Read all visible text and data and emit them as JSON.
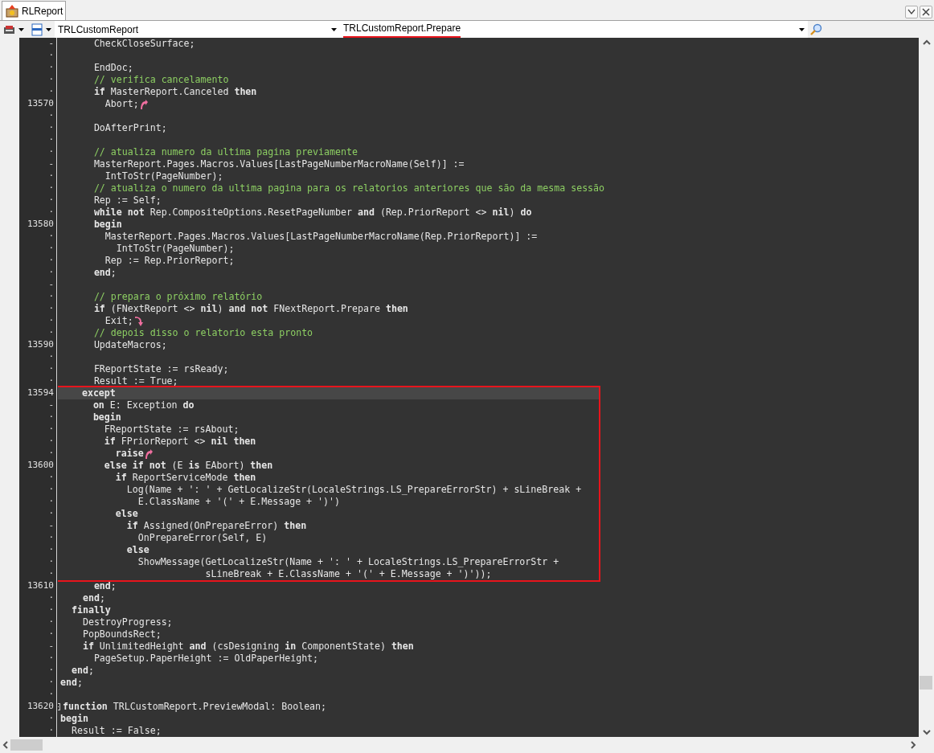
{
  "tab": {
    "label": "RLReport",
    "selected": true
  },
  "toolbar": {
    "class_combo": {
      "value": "TRLCustomReport"
    },
    "method_combo": {
      "value": "TRLCustomReport.Prepare",
      "underlined": true
    }
  },
  "editor": {
    "blocks": [
      {
        "boxed": false,
        "lines": [
          {
            "gutter": "-",
            "kind": "code",
            "text": "      CheckCloseSurface;",
            "current": false
          },
          {
            "gutter": "·",
            "kind": "blank",
            "current": false
          },
          {
            "gutter": "·",
            "kind": "code",
            "text": "      EndDoc;",
            "current": false
          },
          {
            "gutter": "·",
            "kind": "comment",
            "text": "      // verifica cancelamento",
            "current": false
          },
          {
            "gutter": "·",
            "kind": "code",
            "text": "      **if** MasterReport.Canceled **then**",
            "current": false
          },
          {
            "gutter": "13570",
            "kind": "code",
            "text": "        Abort;",
            "arrow": {
              "kind": "up"
            },
            "current": false
          },
          {
            "gutter": "·",
            "kind": "blank",
            "current": false
          },
          {
            "gutter": "·",
            "kind": "code",
            "text": "      DoAfterPrint;",
            "current": false
          },
          {
            "gutter": "·",
            "kind": "blank",
            "current": false
          },
          {
            "gutter": "·",
            "kind": "comment",
            "text": "      // atualiza numero da ultima pagina previamente",
            "current": false
          },
          {
            "gutter": "-",
            "kind": "code",
            "text": "      MasterReport.Pages.Macros.Values[LastPageNumberMacroName(Self)] :=",
            "current": false
          },
          {
            "gutter": "·",
            "kind": "code",
            "text": "        IntToStr(PageNumber);",
            "current": false
          },
          {
            "gutter": "·",
            "kind": "comment",
            "text": "      // atualiza o numero da ultima pagina para os relatorios anteriores que são da mesma sessão",
            "current": false
          },
          {
            "gutter": "·",
            "kind": "code",
            "text": "      Rep := Self;",
            "current": false
          },
          {
            "gutter": "·",
            "kind": "code",
            "text": "      **while not** Rep.CompositeOptions.ResetPageNumber **and** (Rep.PriorReport <> **nil**) **do**",
            "current": false
          },
          {
            "gutter": "13580",
            "kind": "code",
            "text": "      **begin**",
            "current": false
          },
          {
            "gutter": "·",
            "kind": "code",
            "text": "        MasterReport.Pages.Macros.Values[LastPageNumberMacroName(Rep.PriorReport)] :=",
            "current": false
          },
          {
            "gutter": "·",
            "kind": "code",
            "text": "          IntToStr(PageNumber);",
            "current": false
          },
          {
            "gutter": "·",
            "kind": "code",
            "text": "        Rep := Rep.PriorReport;",
            "current": false
          },
          {
            "gutter": "·",
            "kind": "code",
            "text": "      **end**;",
            "current": false
          },
          {
            "gutter": "-",
            "kind": "blank",
            "current": false
          },
          {
            "gutter": "·",
            "kind": "comment",
            "text": "      // prepara o próximo relatório",
            "current": false
          },
          {
            "gutter": "·",
            "kind": "code",
            "text": "      **if** (FNextReport <> **nil**) **and not** FNextReport.Prepare **then**",
            "current": false
          },
          {
            "gutter": "·",
            "kind": "code",
            "text": "        Exit;",
            "arrow": {
              "kind": "down"
            },
            "current": false
          },
          {
            "gutter": "·",
            "kind": "comment",
            "text": "      // depois disso o relatorio esta pronto",
            "current": false
          },
          {
            "gutter": "13590",
            "kind": "code",
            "text": "      UpdateMacros;",
            "current": false
          },
          {
            "gutter": "·",
            "kind": "blank",
            "current": false
          },
          {
            "gutter": "·",
            "kind": "code",
            "text": "      FReportState := rsReady;",
            "current": false
          },
          {
            "gutter": "·",
            "kind": "code",
            "text": "      Result := True;",
            "current": false
          }
        ]
      },
      {
        "boxed": true,
        "lines": [
          {
            "gutter": "13594",
            "kind": "code",
            "text": "    **except**",
            "current": true
          },
          {
            "gutter": "-",
            "kind": "code",
            "text": "      **on** E: Exception **do**",
            "current": false
          },
          {
            "gutter": "·",
            "kind": "code",
            "text": "      **begin**",
            "current": false
          },
          {
            "gutter": "·",
            "kind": "code",
            "text": "        FReportState := rsAbout;",
            "current": false
          },
          {
            "gutter": "·",
            "kind": "code",
            "text": "        **if** FPriorReport <> **nil then**",
            "current": false
          },
          {
            "gutter": "·",
            "kind": "code",
            "text": "          **raise**",
            "arrow": {
              "kind": "up"
            },
            "current": false
          },
          {
            "gutter": "13600",
            "kind": "code",
            "text": "        **else if not** (E **is** EAbort) **then**",
            "current": false
          },
          {
            "gutter": "·",
            "kind": "code",
            "text": "          **if** ReportServiceMode **then**",
            "current": false
          },
          {
            "gutter": "·",
            "kind": "code",
            "text": "            Log(Name + ': ' + GetLocalizeStr(LocaleStrings.LS_PrepareErrorStr) + sLineBreak +",
            "current": false
          },
          {
            "gutter": "·",
            "kind": "code",
            "text": "              E.ClassName + '(' + E.Message + ')')",
            "current": false
          },
          {
            "gutter": "·",
            "kind": "code",
            "text": "          **else**",
            "current": false
          },
          {
            "gutter": "-",
            "kind": "code",
            "text": "            **if** Assigned(OnPrepareError) **then**",
            "current": false
          },
          {
            "gutter": "·",
            "kind": "code",
            "text": "              OnPrepareError(Self, E)",
            "current": false
          },
          {
            "gutter": "·",
            "kind": "code",
            "text": "            **else**",
            "current": false
          },
          {
            "gutter": "·",
            "kind": "code",
            "text": "              ShowMessage(GetLocalizeStr(Name + ': ' + LocaleStrings.LS_PrepareErrorStr +",
            "current": false
          },
          {
            "gutter": "·",
            "kind": "code",
            "text": "                          sLineBreak + E.ClassName + '(' + E.Message + ')'));",
            "current": false
          }
        ]
      },
      {
        "boxed": false,
        "lines": [
          {
            "gutter": "13610",
            "kind": "code",
            "text": "      **end**;",
            "current": false
          },
          {
            "gutter": "·",
            "kind": "code",
            "text": "    **end**;",
            "current": false
          },
          {
            "gutter": "·",
            "kind": "code",
            "text": "  **finally**",
            "current": false
          },
          {
            "gutter": "·",
            "kind": "code",
            "text": "    DestroyProgress;",
            "current": false
          },
          {
            "gutter": "·",
            "kind": "code",
            "text": "    PopBoundsRect;",
            "current": false
          },
          {
            "gutter": "-",
            "kind": "code",
            "text": "    **if** UnlimitedHeight **and** (csDesigning **in** ComponentState) **then**",
            "current": false
          },
          {
            "gutter": "·",
            "kind": "code",
            "text": "      PageSetup.PaperHeight := OldPaperHeight;",
            "current": false
          },
          {
            "gutter": "·",
            "kind": "code",
            "text": "  **end**;",
            "current": false
          },
          {
            "gutter": "·",
            "kind": "code",
            "text": "**end**;",
            "current": false
          },
          {
            "gutter": "·",
            "kind": "blank",
            "current": false
          },
          {
            "gutter": "13620",
            "kind": "code",
            "text": "**function** TRLCustomReport.PreviewModal: Boolean;",
            "fold": true,
            "current": false
          },
          {
            "gutter": "·",
            "kind": "code",
            "text": "**begin**",
            "current": false
          },
          {
            "gutter": "·",
            "kind": "code",
            "text": "  Result := False;",
            "current": false
          }
        ]
      }
    ]
  }
}
